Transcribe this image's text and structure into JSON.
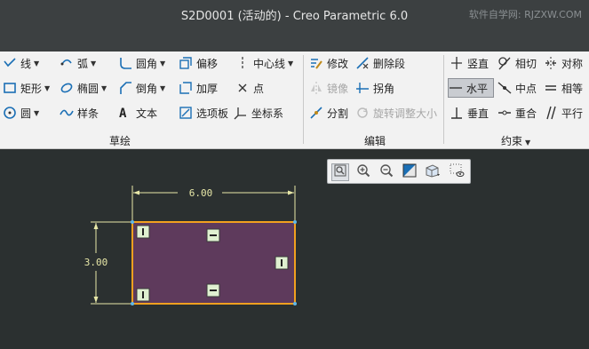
{
  "window": {
    "title": "S2D0001 (活动的) - Creo Parametric 6.0",
    "watermark": "软件自学网: RJZXW.COM"
  },
  "ribbon": {
    "sketch": {
      "group_label": "草绘",
      "items": {
        "line": "线",
        "arc": "弧",
        "fillet": "圆角",
        "offset": "偏移",
        "centerline": "中心线",
        "rectangle": "矩形",
        "ellipse": "椭圆",
        "chamfer": "倒角",
        "thicken": "加厚",
        "point": "点",
        "circle": "圆",
        "spline": "样条",
        "text": "文本",
        "palette": "选项板",
        "coordsys": "坐标系"
      }
    },
    "edit": {
      "group_label": "编辑",
      "items": {
        "modify": "修改",
        "delete_segment": "删除段",
        "mirror": "镜像",
        "corner": "拐角",
        "divide": "分割",
        "rotate_resize": "旋转调整大小"
      }
    },
    "constrain": {
      "group_label": "约束",
      "items": {
        "vertical": "竖直",
        "tangent": "相切",
        "symmetric": "对称",
        "horizontal": "水平",
        "midpoint": "中点",
        "equal": "相等",
        "perpendicular": "垂直",
        "coincident": "重合",
        "parallel": "平行"
      }
    }
  },
  "sketch": {
    "dim_width": "6.00",
    "dim_height": "3.00",
    "fill_color": "#5e3a5c",
    "edge_color": "#f2a01f",
    "dim_color": "#e8e8a8"
  }
}
